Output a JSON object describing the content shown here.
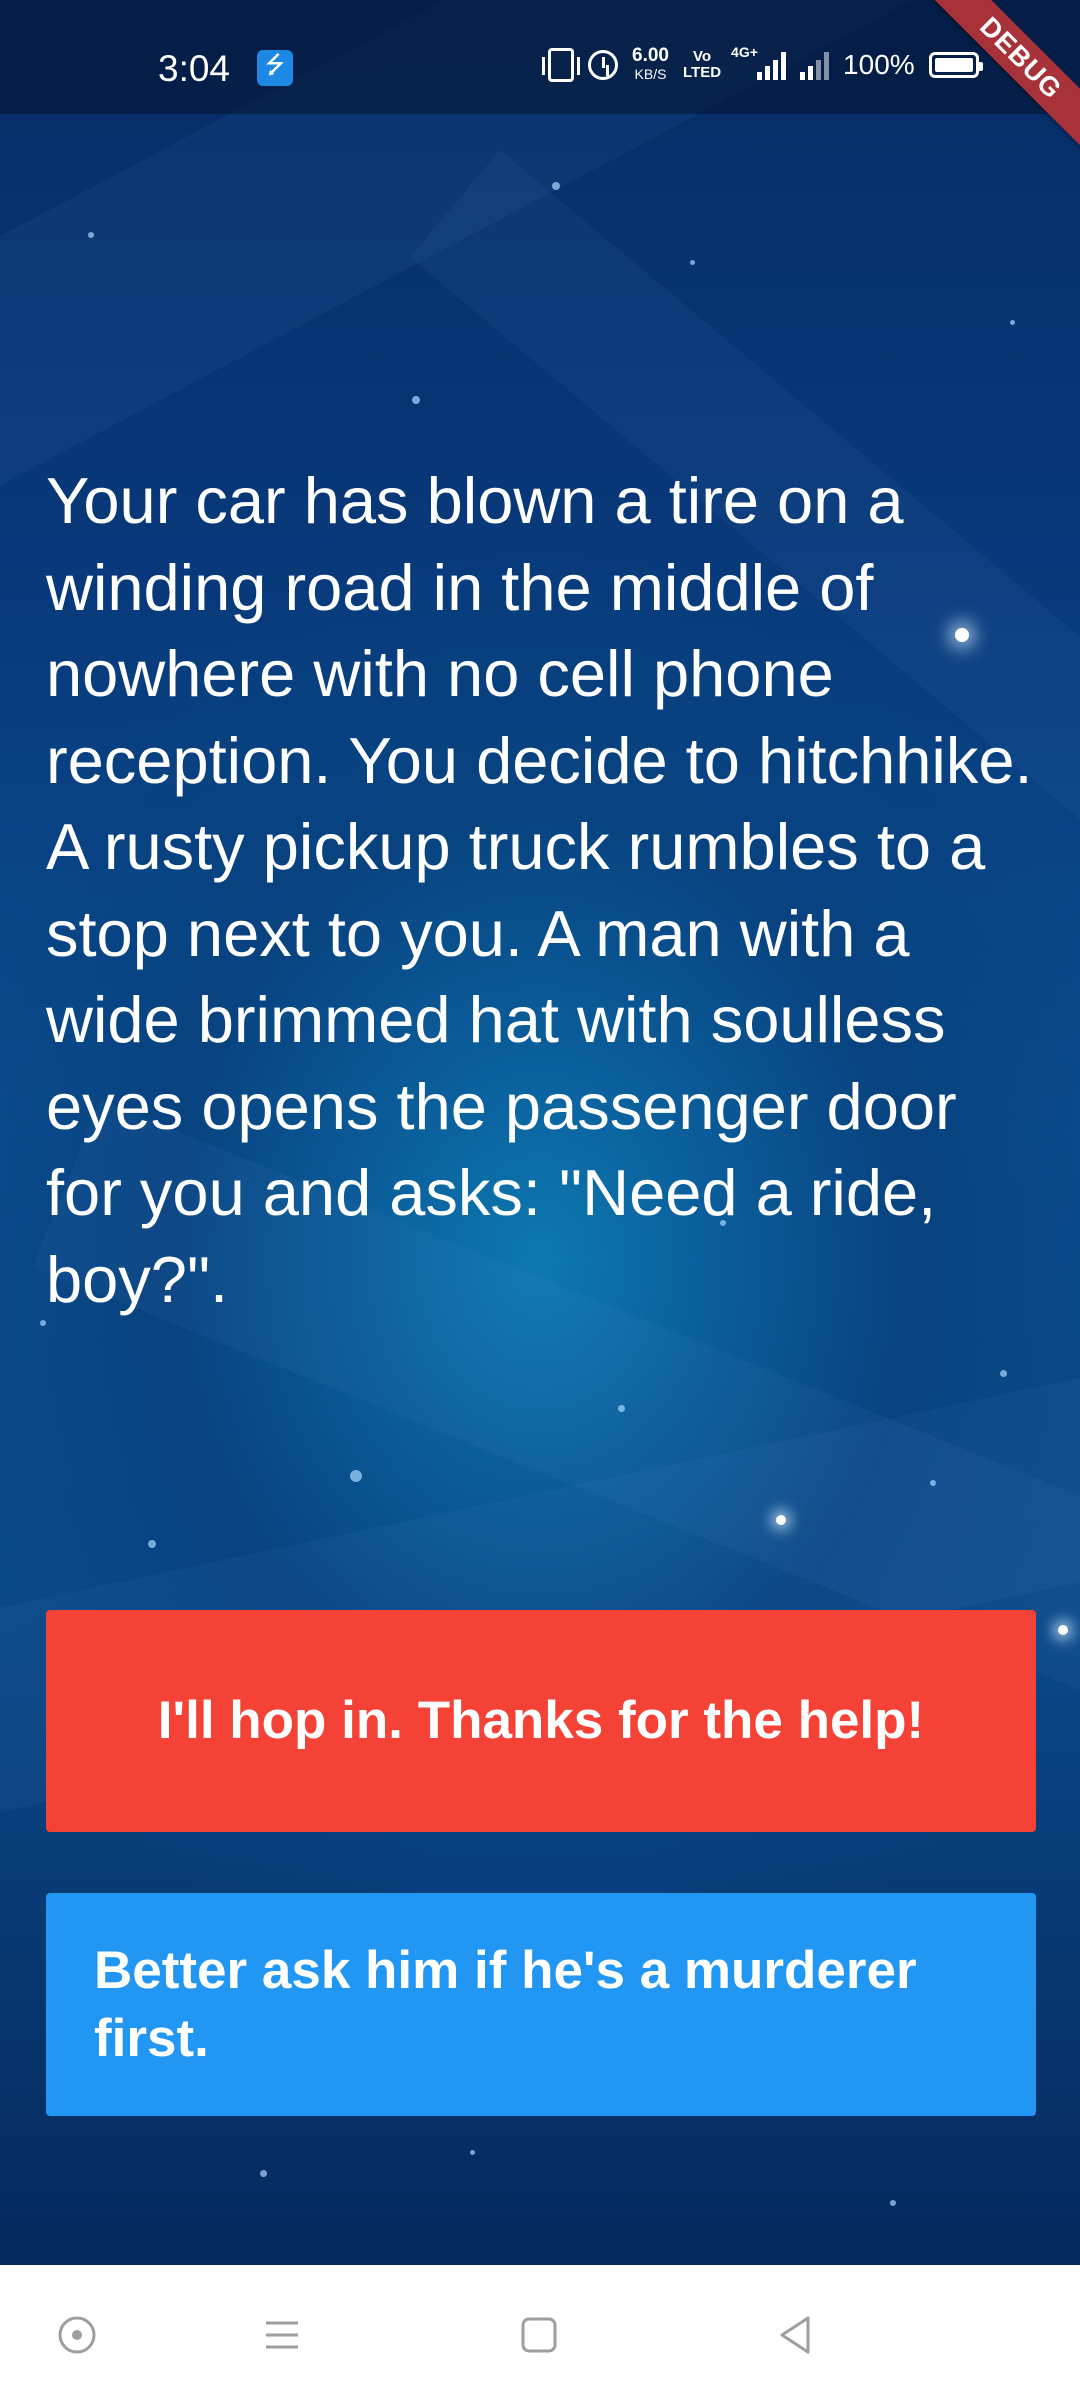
{
  "status_bar": {
    "time": "3:04",
    "net_speed_value": "6.00",
    "net_speed_unit": "KB/S",
    "volte_top": "Vo",
    "volte_bottom": "LTED",
    "network_type": "4G+",
    "battery_text": "100%",
    "battery_level": 1.0
  },
  "debug_banner": "DEBUG",
  "story": {
    "text": "Your car has blown a tire on a winding road in the middle of nowhere with no cell phone reception. You decide to hitchhike. A rusty pickup truck rumbles to a stop next to you. A man with a wide brimmed hat with soulless eyes opens the passenger door for you and asks: \"Need a ride, boy?\"."
  },
  "choices": {
    "choice1_label": "I'll hop in. Thanks for the help!",
    "choice2_label": "Better ask him if he's a murderer first.",
    "choice1_color": "#f44336",
    "choice2_color": "#2196f3"
  },
  "nav_bar": {
    "icons": [
      "assistant-icon",
      "menu-icon",
      "home-icon",
      "back-icon"
    ]
  }
}
